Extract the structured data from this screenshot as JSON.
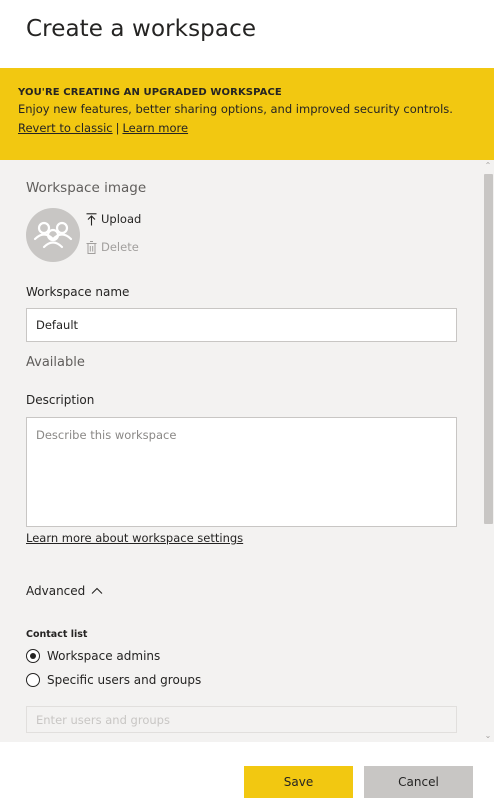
{
  "header": {
    "title": "Create a workspace"
  },
  "banner": {
    "title": "YOU'RE CREATING AN UPGRADED WORKSPACE",
    "text": "Enjoy new features, better sharing options, and improved security controls.",
    "revert_link": "Revert to classic",
    "separator": "|",
    "learn_more_link": "Learn more",
    "background": "#f2c811"
  },
  "workspace_image": {
    "label": "Workspace image",
    "avatar_icon": "people-group-icon",
    "upload_label": "Upload",
    "delete_label": "Delete"
  },
  "workspace_name": {
    "label": "Workspace name",
    "value": "Default",
    "status": "Available"
  },
  "description": {
    "label": "Description",
    "placeholder": "Describe this workspace"
  },
  "settings_link": "Learn more about workspace settings",
  "advanced": {
    "label": "Advanced",
    "expanded": true,
    "contact_list": {
      "label": "Contact list",
      "options": [
        {
          "label": "Workspace admins",
          "selected": true
        },
        {
          "label": "Specific users and groups",
          "selected": false
        }
      ],
      "users_placeholder": "Enter users and groups"
    }
  },
  "footer": {
    "save_label": "Save",
    "cancel_label": "Cancel"
  },
  "colors": {
    "accent": "#f2c811",
    "panel": "#f3f2f1",
    "cancel": "#c8c6c4"
  }
}
